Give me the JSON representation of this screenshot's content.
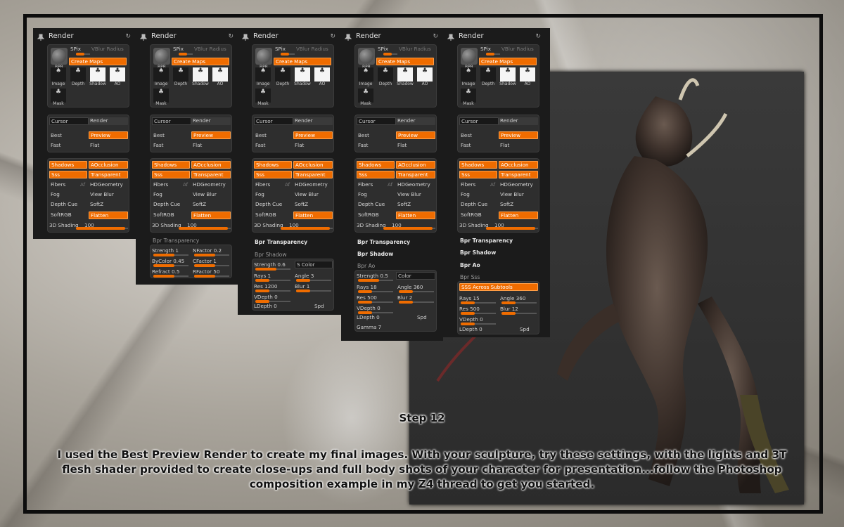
{
  "panels": [
    {
      "title": "Render",
      "sections": [
        "render"
      ],
      "extra": []
    },
    {
      "title": "Render",
      "sections": [
        "render"
      ],
      "extra": [
        "transparency"
      ]
    },
    {
      "title": "Render",
      "sections": [
        "render"
      ],
      "extra": [
        "shadow"
      ]
    },
    {
      "title": "Render",
      "sections": [
        "render"
      ],
      "extra": [
        "ao"
      ]
    },
    {
      "title": "Render",
      "sections": [
        "render"
      ],
      "extra": [
        "sss"
      ]
    }
  ],
  "common": {
    "spix": "SPix",
    "vblur": "VBlur Radius",
    "bpr": "BPR",
    "create_maps": "Create Maps",
    "thumb_image": "Image",
    "thumb_depth": "Depth",
    "thumb_shadow": "Shadow",
    "thumb_ao": "AO",
    "thumb_mask": "Mask",
    "cursor": "Cursor",
    "render": "Render",
    "best": "Best",
    "preview": "Preview",
    "fast": "Fast",
    "flat": "Flat",
    "shadows": "Shadows",
    "aocclusion": "AOcclusion",
    "sss": "Sss",
    "transparent": "Transparent",
    "fibers": "Fibers",
    "af": "Af",
    "hdgeometry": "HDGeometry",
    "fog": "Fog",
    "view_blur": "View Blur",
    "depth_cue": "Depth Cue",
    "softz": "SoftZ",
    "softrgb": "SoftRGB",
    "flatten": "Flatten",
    "shading_label": "3D Shading",
    "shading_value": "100"
  },
  "sections": {
    "bpr_transparency": "Bpr Transparency",
    "bpr_shadow": "Bpr Shadow",
    "bpr_ao": "Bpr Ao",
    "bpr_sss": "Bpr Sss"
  },
  "transparency": {
    "strength": "Strength 1",
    "nfactor": "NFactor 0.2",
    "bycolor": "ByColor 0.45",
    "cfactor": "CFactor 1",
    "refract": "Refract 0.5",
    "rfactor": "RFactor 50"
  },
  "shadow": {
    "strength": "Strength 0.6",
    "color": "S Color",
    "rays": "Rays 1",
    "angle": "Angle 3",
    "res": "Res 1200",
    "blur": "Blur 1",
    "vdepth": "VDepth 0",
    "ldepth": "LDepth 0",
    "spd": "Spd"
  },
  "ao": {
    "strength": "Strength 0.5",
    "color": "Color",
    "rays": "Rays 18",
    "angle": "Angle 360",
    "res": "Res 500",
    "blur": "Blur 2",
    "vdepth": "VDepth 0",
    "ldepth": "LDepth 0",
    "spd": "Spd",
    "gamma": "Gamma 7"
  },
  "sss": {
    "across": "SSS Across Subtools",
    "rays": "Rays 15",
    "angle": "Angle 360",
    "res": "Res 500",
    "blur": "Blur 12",
    "vdepth": "VDepth 0",
    "ldepth": "LDepth 0",
    "spd": "Spd"
  },
  "caption": {
    "step": "Step 12",
    "body": "I used the Best Preview Render to create my final images. With your sculpture, try these settings, with the lights and 3T flesh shader provided to create close-ups and full body shots of your character for presentation...follow the Photoshop composition example in my Z4 thread to get you started."
  },
  "colors": {
    "accent": "#ef6c00",
    "panel": "#1b1b1b"
  }
}
